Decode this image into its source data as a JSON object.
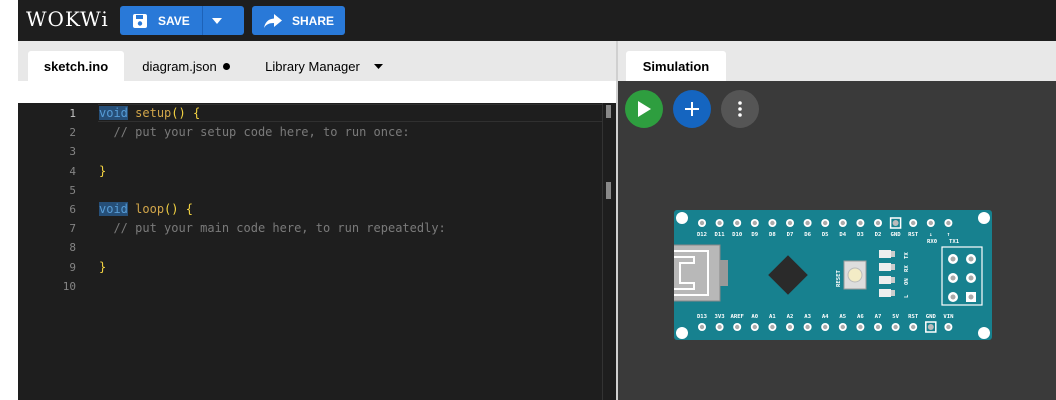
{
  "header": {
    "logo": "WOKWi",
    "save_label": "SAVE",
    "share_label": "SHARE"
  },
  "editor": {
    "tabs": [
      {
        "label": "sketch.ino",
        "active": true
      },
      {
        "label": "diagram.json",
        "unsaved": true
      },
      {
        "label": "Library Manager",
        "dropdown": true
      }
    ],
    "code": [
      {
        "n": "1",
        "parts": [
          {
            "t": "void",
            "c": "kw"
          },
          {
            "t": " "
          },
          {
            "t": "setup",
            "c": "fn"
          },
          {
            "t": "() {",
            "c": "par"
          }
        ]
      },
      {
        "n": "2",
        "parts": [
          {
            "t": "  // put your setup code here, to run once:",
            "c": "cm"
          }
        ]
      },
      {
        "n": "3",
        "parts": []
      },
      {
        "n": "4",
        "parts": [
          {
            "t": "}",
            "c": "par"
          }
        ]
      },
      {
        "n": "5",
        "parts": []
      },
      {
        "n": "6",
        "parts": [
          {
            "t": "void",
            "c": "kw"
          },
          {
            "t": " "
          },
          {
            "t": "loop",
            "c": "fn"
          },
          {
            "t": "() {",
            "c": "par"
          }
        ]
      },
      {
        "n": "7",
        "parts": [
          {
            "t": "  // put your main code here, to run repeatedly:",
            "c": "cm"
          }
        ]
      },
      {
        "n": "8",
        "parts": []
      },
      {
        "n": "9",
        "parts": [
          {
            "t": "}",
            "c": "par"
          }
        ]
      },
      {
        "n": "10",
        "parts": []
      }
    ]
  },
  "simulation": {
    "tab_label": "Simulation",
    "buttons": [
      {
        "name": "play-icon",
        "color": "#2e9e3f"
      },
      {
        "name": "plus-icon",
        "color": "#1565c0"
      },
      {
        "name": "more-vertical-icon",
        "color": "#555555"
      }
    ],
    "board": {
      "name": "Arduino Nano",
      "color": "#17818f",
      "top_pins": [
        "D12",
        "D11",
        "D10",
        "D9",
        "D8",
        "D7",
        "D6",
        "D5",
        "D4",
        "D3",
        "D2",
        "GND",
        "RST",
        "↓",
        "↑"
      ],
      "top_pins_sub": [
        "RX0",
        "TX1"
      ],
      "bottom_pins": [
        "D13",
        "3V3",
        "AREF",
        "A0",
        "A1",
        "A2",
        "A3",
        "A4",
        "A5",
        "A6",
        "A7",
        "5V",
        "RST",
        "GND",
        "VIN"
      ],
      "reset_label": "RESET",
      "led_labels": [
        "TX",
        "RX",
        "ON",
        "L"
      ]
    }
  }
}
